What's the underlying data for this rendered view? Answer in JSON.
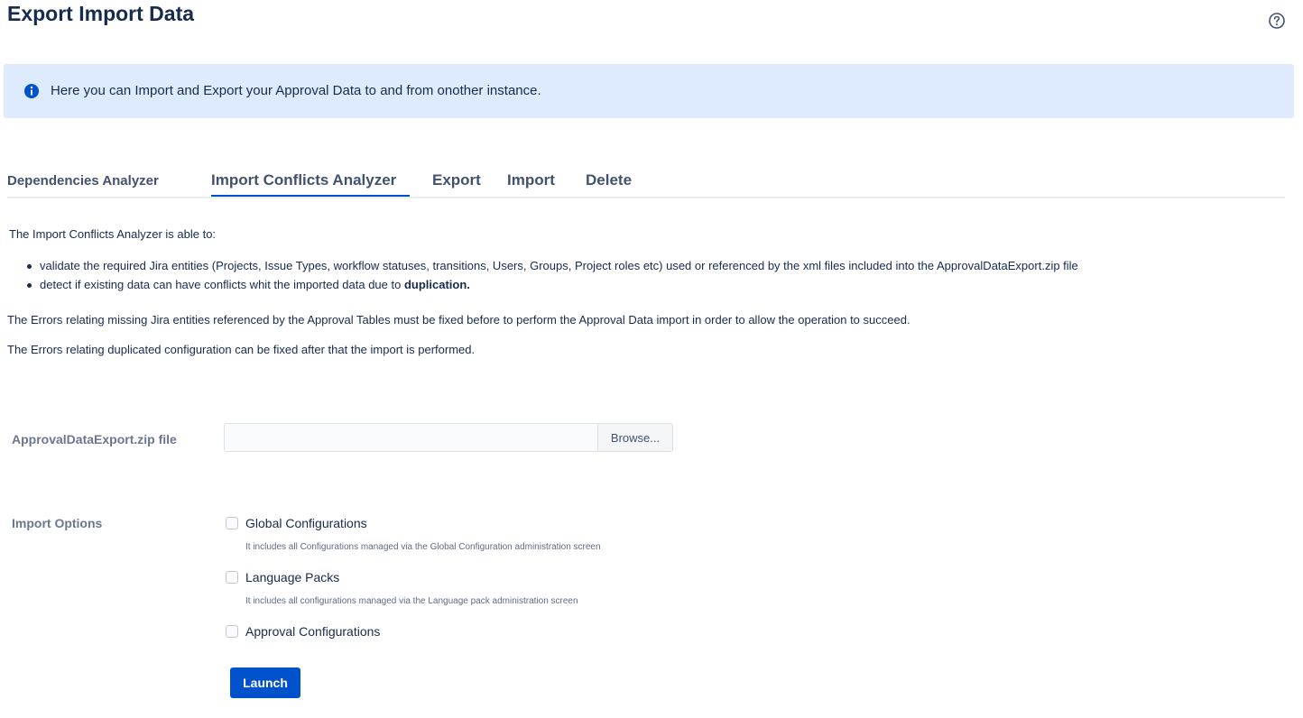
{
  "header": {
    "title": "Export Import Data",
    "help_icon": "help-circle-icon"
  },
  "banner": {
    "icon": "info-icon",
    "text": "Here you can Import and Export your Approval Data to and from onother instance."
  },
  "tabs": [
    {
      "label": "Dependencies Analyzer",
      "active": false
    },
    {
      "label": "Import Conflicts Analyzer",
      "active": true
    },
    {
      "label": "Export",
      "active": false
    },
    {
      "label": "Import",
      "active": false
    },
    {
      "label": "Delete",
      "active": false
    }
  ],
  "content": {
    "intro": "The Import Conflicts Analyzer is able to:",
    "bullets": [
      {
        "text": "validate the required Jira entities (Projects, Issue Types, workflow statuses, transitions, Users, Groups, Project roles etc) used or referenced by the xml files included into the ApprovalDataExport.zip file"
      },
      {
        "text": "detect if existing data can have conflicts whit the imported data due to ",
        "bold": "duplication."
      }
    ],
    "para1": "The Errors relating missing Jira entities referenced by the Approval Tables must be fixed before to perform the Approval Data import in order to allow the operation to succeed.",
    "para2": "The Errors relating duplicated configuration can be fixed after that the import is performed."
  },
  "form": {
    "file_label": "ApprovalDataExport.zip file",
    "file_value": "",
    "browse_label": "Browse...",
    "options_label": "Import Options",
    "options": [
      {
        "label": "Global Configurations",
        "checked": false,
        "description": "It includes all Configurations managed via the Global Configuration administration screen"
      },
      {
        "label": "Language Packs",
        "checked": false,
        "description": "It includes all configurations managed via the Language pack administration screen"
      },
      {
        "label": "Approval Configurations",
        "checked": false,
        "description": ""
      }
    ],
    "launch_label": "Launch"
  },
  "colors": {
    "banner_bg": "#deebff",
    "info_icon": "#0052cc",
    "primary_button": "#0052cc",
    "active_tab_underline": "#0052cc"
  }
}
